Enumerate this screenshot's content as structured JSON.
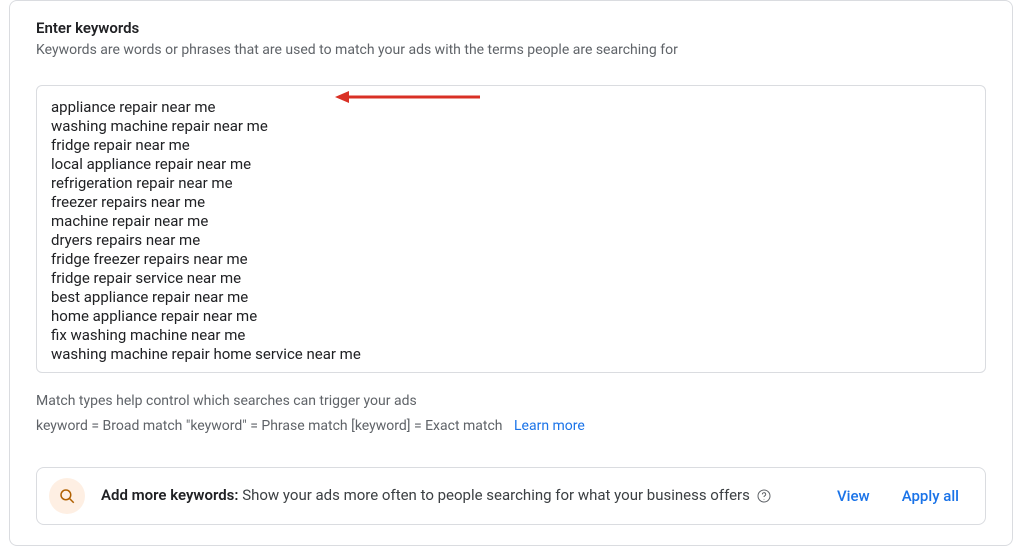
{
  "title": "Enter keywords",
  "subtitle": "Keywords are words or phrases that are used to match your ads with the terms people are searching for",
  "keywords": [
    "appliance repair near me",
    "washing machine repair near me",
    "fridge repair near me",
    "local appliance repair near me",
    "refrigeration repair near me",
    "freezer repairs near me",
    "machine repair near me",
    "dryers repairs near me",
    "fridge freezer repairs near me",
    "fridge repair service near me",
    "best appliance repair near me",
    "home appliance repair near me",
    "fix washing machine near me",
    "washing machine repair home service near me"
  ],
  "help": {
    "line1": "Match types help control which searches can trigger your ads",
    "line2": "keyword = Broad match   \"keyword\" = Phrase match   [keyword] = Exact match",
    "learnMore": "Learn more"
  },
  "addMore": {
    "boldPrefix": "Add more keywords:",
    "body": " Show your ads more often to people searching for what your business offers ",
    "viewLabel": "View",
    "applyAllLabel": "Apply all"
  }
}
